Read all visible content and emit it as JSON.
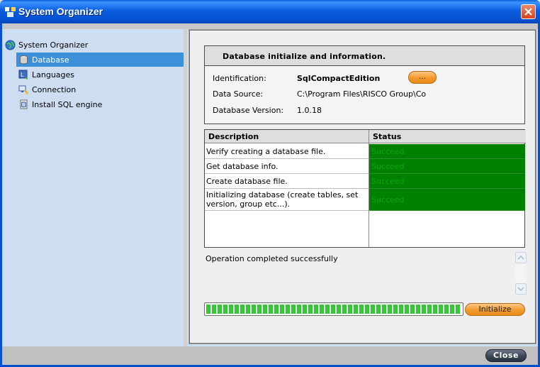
{
  "window": {
    "title": "System Organizer"
  },
  "sidebar": {
    "root_label": "System Organizer",
    "items": [
      {
        "label": "Database",
        "icon": "database-icon",
        "selected": true
      },
      {
        "label": "Languages",
        "icon": "languages-icon",
        "selected": false
      },
      {
        "label": "Connection",
        "icon": "connection-icon",
        "selected": false
      },
      {
        "label": "Install SQL engine",
        "icon": "install-sql-icon",
        "selected": false
      }
    ]
  },
  "info": {
    "header": "Database initialize and information.",
    "identification_label": "Identification:",
    "identification_value": "SqlCompactEdition",
    "browse_label": "...",
    "data_source_label": "Data Source:",
    "data_source_value": "C:\\Program Files\\RISCO Group\\Co",
    "version_label": "Database Version:",
    "version_value": "1.0.18"
  },
  "table": {
    "columns": [
      "Description",
      "Status"
    ],
    "rows": [
      {
        "description": "Verify creating a database file.",
        "status": "Succeed"
      },
      {
        "description": "Get database info.",
        "status": "Succeed"
      },
      {
        "description": "Create database file.",
        "status": "Succeed"
      },
      {
        "description": "Initializing database (create tables, set version, group etc...).",
        "status": "Succeed"
      }
    ]
  },
  "log": {
    "message": "Operation completed successfully"
  },
  "progress": {
    "value": 1.0
  },
  "buttons": {
    "initialize": "Initialize",
    "close": "Close"
  },
  "colors": {
    "status_ok": "#008000",
    "selection": "#3c8fd9",
    "progress": "#37c637"
  }
}
